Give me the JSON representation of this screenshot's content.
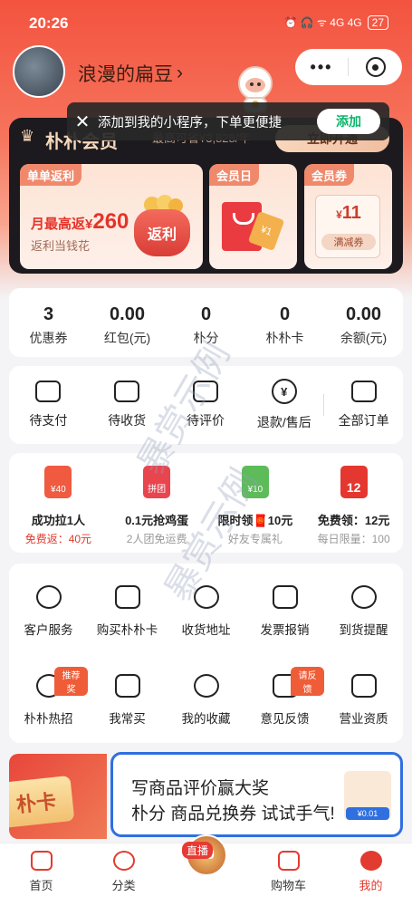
{
  "status_bar": {
    "time": "20:26",
    "icons": "⏰ 🎧 ᯤ 4G 4G",
    "battery": "27"
  },
  "user": {
    "name": "浪漫的扁豆",
    "chevron": "›"
  },
  "capsule": {
    "more": "•••"
  },
  "toast": {
    "close": "✕",
    "text": "添加到我的小程序，下单更便捷",
    "add_label": "添加"
  },
  "membership": {
    "crown": "♛",
    "title": "朴朴会员",
    "savings": "最高可省¥3,828/年",
    "button": "立即开通"
  },
  "cards": {
    "cashback": {
      "tag": "单单返利",
      "amount_prefix": "月最高返¥",
      "amount": "260",
      "sub": "返利当钱花",
      "pouch_label": "返利"
    },
    "member_day": {
      "tag": "会员日",
      "tag_text": "¥1"
    },
    "member_coupon": {
      "tag": "会员券",
      "currency": "¥",
      "amount": "11",
      "sub": "满减券"
    }
  },
  "assets": [
    {
      "value": "3",
      "label": "优惠券"
    },
    {
      "value": "0.00",
      "label": "红包(元)"
    },
    {
      "value": "0",
      "label": "朴分"
    },
    {
      "value": "0",
      "label": "朴朴卡"
    },
    {
      "value": "0.00",
      "label": "余额(元)"
    }
  ],
  "orders": [
    {
      "label": "待支付"
    },
    {
      "label": "待收货"
    },
    {
      "label": "待评价"
    },
    {
      "label": "退款/售后",
      "glyph": "¥"
    },
    {
      "label": "全部订单"
    }
  ],
  "promos": [
    {
      "icon_text": "¥40",
      "title": "成功拉1人",
      "sub": "免费返：40元",
      "color": "#ef5a40"
    },
    {
      "icon_text": "拼团",
      "title": "0.1元抢鸡蛋",
      "sub": "2人团免运费",
      "color": "#e9454f"
    },
    {
      "icon_text": "¥10",
      "title": "限时领🧧10元",
      "sub": "好友专属礼",
      "color": "#5dbb5a"
    },
    {
      "icon_text": "12",
      "title": "免费领：12元",
      "sub": "每日限量：100",
      "color": "#e4372f"
    }
  ],
  "services_row1": [
    {
      "label": "客户服务"
    },
    {
      "label": "购买朴朴卡"
    },
    {
      "label": "收货地址"
    },
    {
      "label": "发票报销"
    },
    {
      "label": "到货提醒"
    }
  ],
  "services_row2": [
    {
      "label": "朴朴热招",
      "badge": "推荐奖"
    },
    {
      "label": "我常买"
    },
    {
      "label": "我的收藏"
    },
    {
      "label": "意见反馈",
      "badge": "请反馈"
    },
    {
      "label": "营业资质"
    }
  ],
  "banner": {
    "left_text": "朴卡",
    "line1": "写商品评价赢大奖",
    "line2": "朴分 商品兑换券 试试手气!",
    "price": "¥0.01"
  },
  "tabbar": [
    {
      "label": "首页"
    },
    {
      "label": "分类"
    },
    {
      "label": "",
      "live": "直播",
      "live_num": "10"
    },
    {
      "label": "购物车"
    },
    {
      "label": "我的"
    }
  ],
  "watermark": "暴赏示例",
  "colors": {
    "accent": "#e23b30",
    "header": "#f3533f",
    "wechat_green": "#08b56a"
  }
}
